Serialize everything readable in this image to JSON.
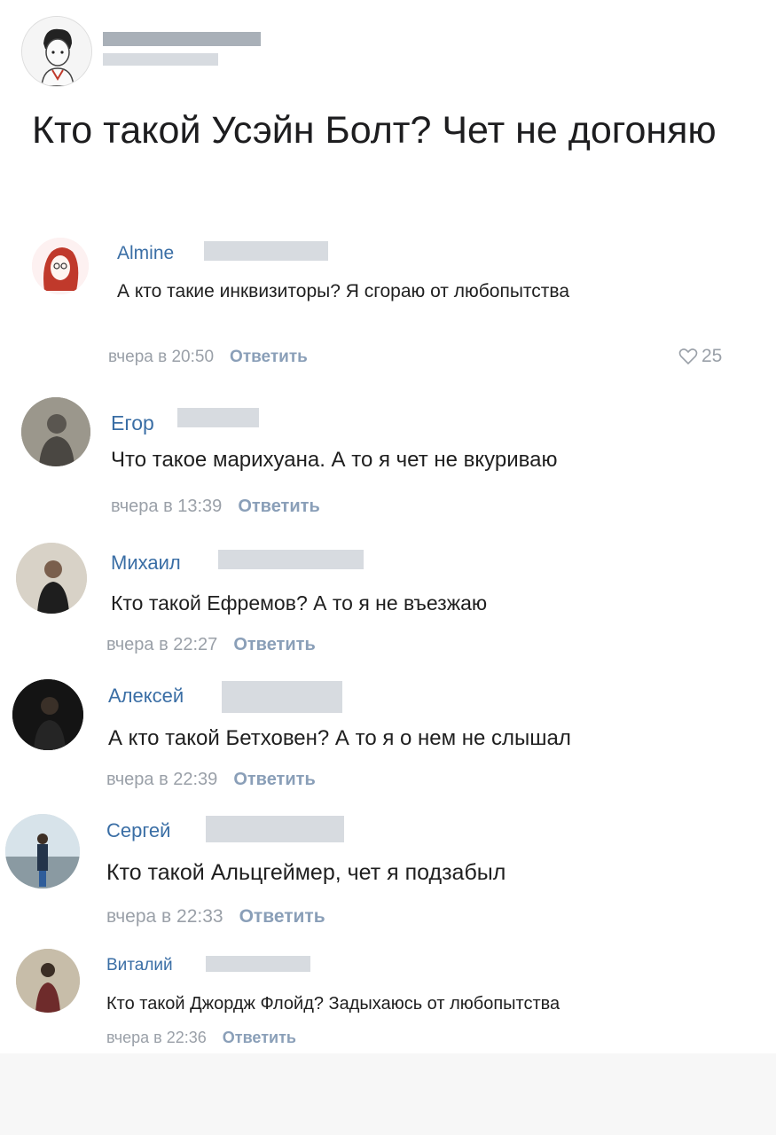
{
  "post": {
    "text": "Кто такой Усэйн Болт? Чет не догоняю"
  },
  "comments": [
    {
      "author": "Almine",
      "text": "А кто такие инквизиторы? Я сгораю от любопытства",
      "time": "вчера в 20:50",
      "reply": "Ответить",
      "likes": "25"
    },
    {
      "author": "Егор",
      "text": "Что такое марихуана. А то я чет не вкуриваю",
      "time": "вчера в 13:39",
      "reply": "Ответить"
    },
    {
      "author": "Михаил",
      "text": "Кто такой Ефремов? А то я не въезжаю",
      "time": "вчера в 22:27",
      "reply": "Ответить"
    },
    {
      "author": "Алексей",
      "text": "А кто такой Бетховен? А то я о нем не слышал",
      "time": "вчера в 22:39",
      "reply": "Ответить"
    },
    {
      "author": "Сергей",
      "text": "Кто такой Альцгеймер, чет я подзабыл",
      "time": "вчера в 22:33",
      "reply": "Ответить"
    },
    {
      "author": "Виталий",
      "text": "Кто такой Джордж Флойд? Задыхаюсь от любопытства",
      "time": "вчера в 22:36",
      "reply": "Ответить"
    }
  ],
  "colors": {
    "author": "#3a6ea5",
    "meta": "#9aa0a8",
    "reply": "#8a9fb8"
  }
}
